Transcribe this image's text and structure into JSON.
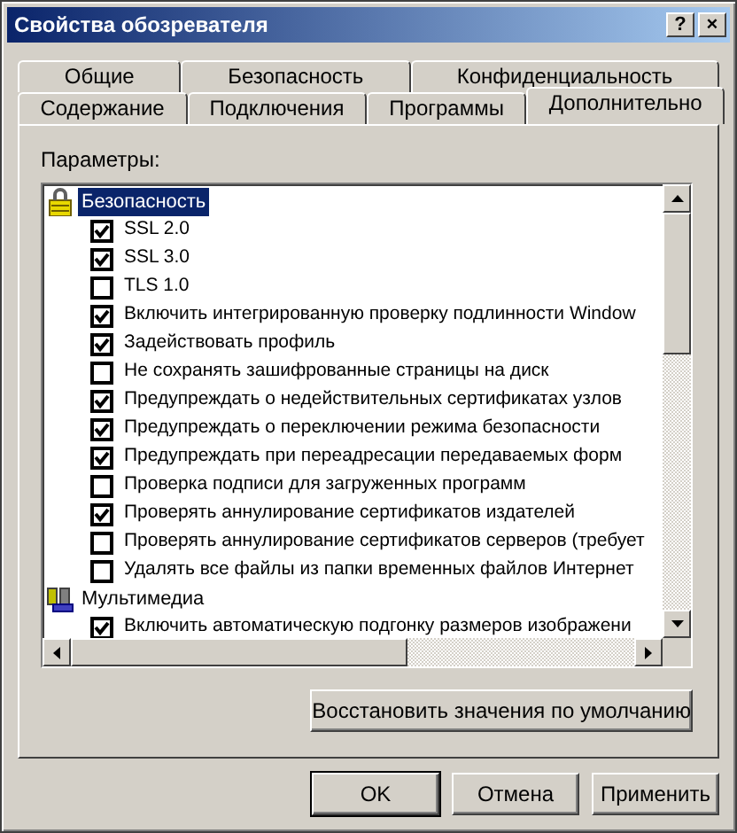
{
  "window": {
    "title": "Свойства обозревателя",
    "help_button": "?",
    "close_button": "×"
  },
  "tab_rows": [
    [
      {
        "label": "Общие",
        "selected": false
      },
      {
        "label": "Безопасность",
        "selected": false
      },
      {
        "label": "Конфиденциальность",
        "selected": false
      }
    ],
    [
      {
        "label": "Содержание",
        "selected": false
      },
      {
        "label": "Подключения",
        "selected": false
      },
      {
        "label": "Программы",
        "selected": false
      },
      {
        "label": "Дополнительно",
        "selected": true
      }
    ]
  ],
  "settings_label": "Параметры:",
  "settings_tree": [
    {
      "label": "Безопасность",
      "selected": true,
      "children": [
        {
          "label": "SSL 2.0",
          "checked": true
        },
        {
          "label": "SSL 3.0",
          "checked": true
        },
        {
          "label": "TLS 1.0",
          "checked": false
        },
        {
          "label": "Включить интегрированную проверку подлинности Window",
          "checked": true
        },
        {
          "label": "Задействовать профиль",
          "checked": true
        },
        {
          "label": "Не сохранять зашифрованные страницы на диск",
          "checked": false
        },
        {
          "label": "Предупреждать о недействительных сертификатах узлов",
          "checked": true
        },
        {
          "label": "Предупреждать о переключении режима безопасности",
          "checked": true
        },
        {
          "label": "Предупреждать при переадресации передаваемых форм",
          "checked": true
        },
        {
          "label": "Проверка подписи для загруженных программ",
          "checked": false
        },
        {
          "label": "Проверять аннулирование сертификатов издателей",
          "checked": true
        },
        {
          "label": "Проверять аннулирование сертификатов серверов (требует",
          "checked": false
        },
        {
          "label": "Удалять все файлы из папки временных файлов Интернет",
          "checked": false
        }
      ]
    },
    {
      "label": "Мультимедиа",
      "selected": false,
      "children": [
        {
          "label": "Включить автоматическую подгонку размеров изображени",
          "checked": true
        }
      ]
    }
  ],
  "restore_button": "Восстановить значения по умолчанию",
  "buttons": [
    {
      "label": "OK",
      "default": true
    },
    {
      "label": "Отмена",
      "default": false
    },
    {
      "label": "Применить",
      "default": false
    }
  ]
}
